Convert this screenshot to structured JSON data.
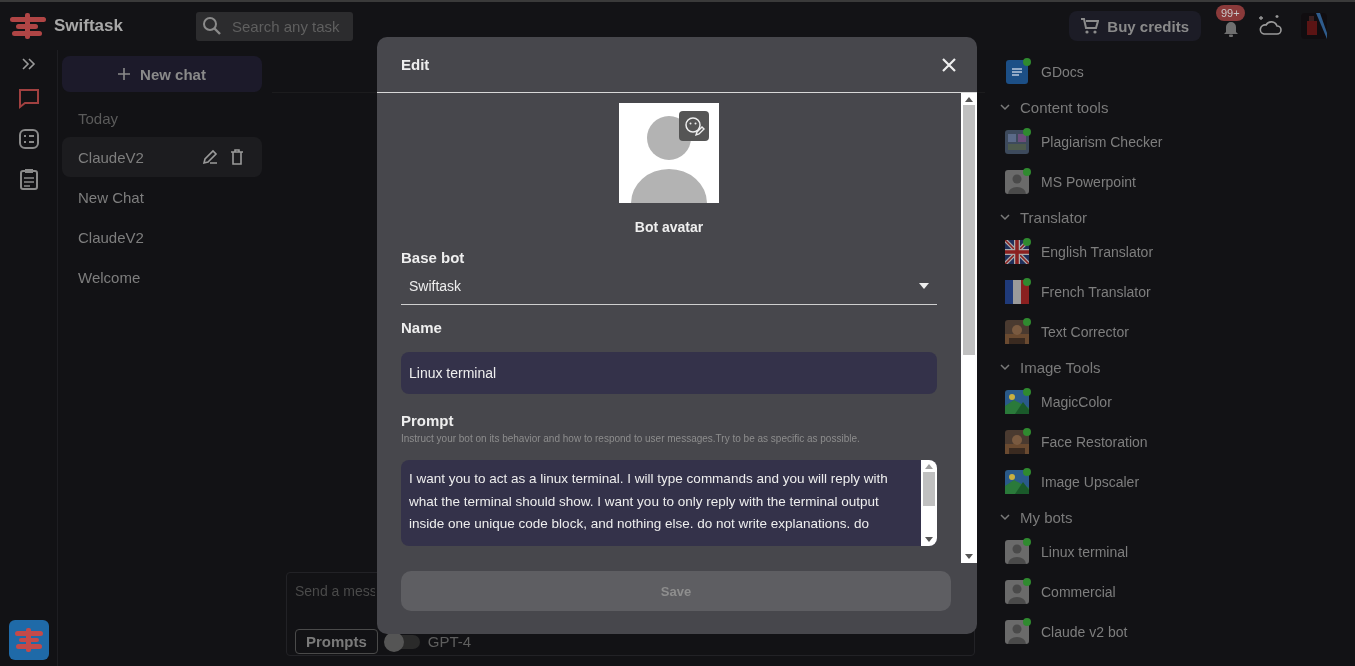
{
  "app": {
    "name": "Swiftask"
  },
  "search": {
    "placeholder": "Search any task"
  },
  "topbar": {
    "buy_credits": "Buy credits",
    "notifications_badge": "99+"
  },
  "nav_items": [
    {
      "kind": "chat",
      "selected": true
    },
    {
      "kind": "tasks",
      "selected": false
    },
    {
      "kind": "clipboard",
      "selected": false
    }
  ],
  "chats": {
    "new_chat": "New chat",
    "section": "Today",
    "items": [
      {
        "title": "ClaudeV2",
        "selected": true
      },
      {
        "title": "New Chat",
        "selected": false
      },
      {
        "title": "ClaudeV2",
        "selected": false
      },
      {
        "title": "Welcome",
        "selected": false
      }
    ]
  },
  "composer": {
    "placeholder": "Send a mess",
    "prompts": "Prompts",
    "toggle_on": false,
    "model": "GPT-4"
  },
  "bot_groups": [
    {
      "items": [
        {
          "name": "GDocs",
          "kind": "doc",
          "online": true
        }
      ]
    },
    {
      "title": "Content tools",
      "expanded": true,
      "items": [
        {
          "name": "Plagiarism Checker",
          "kind": "grid",
          "online": true
        },
        {
          "name": "MS Powerpoint",
          "kind": "avatar",
          "online": true
        }
      ]
    },
    {
      "title": "Translator",
      "expanded": true,
      "items": [
        {
          "name": "English Translator",
          "kind": "flag-uk",
          "online": true
        },
        {
          "name": "French Translator",
          "kind": "flag-fr",
          "online": true
        },
        {
          "name": "Text Corrector",
          "kind": "picture",
          "online": true
        }
      ]
    },
    {
      "title": "Image Tools",
      "expanded": true,
      "items": [
        {
          "name": "MagicColor",
          "kind": "landscape",
          "online": true
        },
        {
          "name": "Face Restoration",
          "kind": "picture",
          "online": true
        },
        {
          "name": "Image Upscaler",
          "kind": "landscape",
          "online": true
        }
      ]
    },
    {
      "title": "My bots",
      "expanded": true,
      "items": [
        {
          "name": "Linux terminal",
          "kind": "avatar",
          "online": true
        },
        {
          "name": "Commercial",
          "kind": "avatar",
          "online": true
        },
        {
          "name": "Claude v2 bot",
          "kind": "avatar",
          "online": true
        }
      ]
    }
  ],
  "dialog": {
    "title": "Edit",
    "avatar_label": "Bot avatar",
    "base_bot_label": "Base bot",
    "base_bot": "Swiftask",
    "name_label": "Name",
    "name": "Linux terminal",
    "prompt_label": "Prompt",
    "prompt_hint": "Instruct your bot on its behavior and how to respond to user messages.Try to be as specific as possible.",
    "prompt": "I want you to act as a linux terminal. I will type commands and you will reply with what the terminal should show. I want you to only reply with the terminal output inside one unique code block, and nothing else. do not write explanations. do",
    "save": "Save",
    "save_disabled": true
  }
}
